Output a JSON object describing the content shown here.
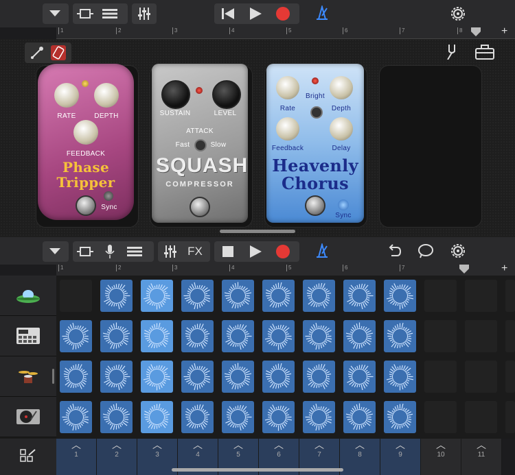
{
  "top_toolbar": {
    "ruler_marks": [
      "1",
      "2",
      "3",
      "4",
      "5",
      "6",
      "7",
      "8"
    ]
  },
  "pedals": {
    "phase": {
      "knob_rate": "RATE",
      "knob_depth": "DEPTH",
      "knob_feedback": "FEEDBACK",
      "name_line1": "Phase",
      "name_line2": "Tripper",
      "sync": "Sync"
    },
    "squash": {
      "knob_sustain": "SUSTAIN",
      "knob_level": "LEVEL",
      "attack": "ATTACK",
      "fast": "Fast",
      "slow": "Slow",
      "name": "SQUASH",
      "sub": "COMPRESSOR"
    },
    "chorus": {
      "knob_rate": "Rate",
      "bright": "Bright",
      "knob_depth": "Depth",
      "knob_feedback": "Feedback",
      "knob_delay": "Delay",
      "name_line1": "Heavenly",
      "name_line2": "Chorus",
      "sync": "Sync"
    }
  },
  "bottom_toolbar": {
    "fx_label": "FX",
    "ruler_marks": [
      "1",
      "2",
      "3",
      "4",
      "5",
      "6",
      "7"
    ]
  },
  "grid": {
    "rows": [
      {
        "track": "ufo-synth",
        "cells": [
          0,
          1,
          2,
          1,
          1,
          1,
          1,
          1,
          1,
          0,
          0,
          0
        ]
      },
      {
        "track": "drum-machine",
        "cells": [
          1,
          1,
          2,
          1,
          1,
          1,
          1,
          1,
          1,
          0,
          0,
          0
        ]
      },
      {
        "track": "drums",
        "cells": [
          1,
          1,
          2,
          1,
          1,
          1,
          1,
          1,
          1,
          0,
          0,
          0
        ]
      },
      {
        "track": "turntable",
        "cells": [
          1,
          1,
          2,
          1,
          1,
          1,
          1,
          1,
          1,
          0,
          0,
          0
        ]
      }
    ],
    "triggers": [
      "1",
      "2",
      "3",
      "4",
      "5",
      "6",
      "7",
      "8",
      "9",
      "10",
      "11"
    ]
  },
  "colors": {
    "cell_on": "#3b6fb0",
    "cell_highlight": "#5a9be0",
    "record": "#e53935",
    "accent": "#3d8bff"
  }
}
